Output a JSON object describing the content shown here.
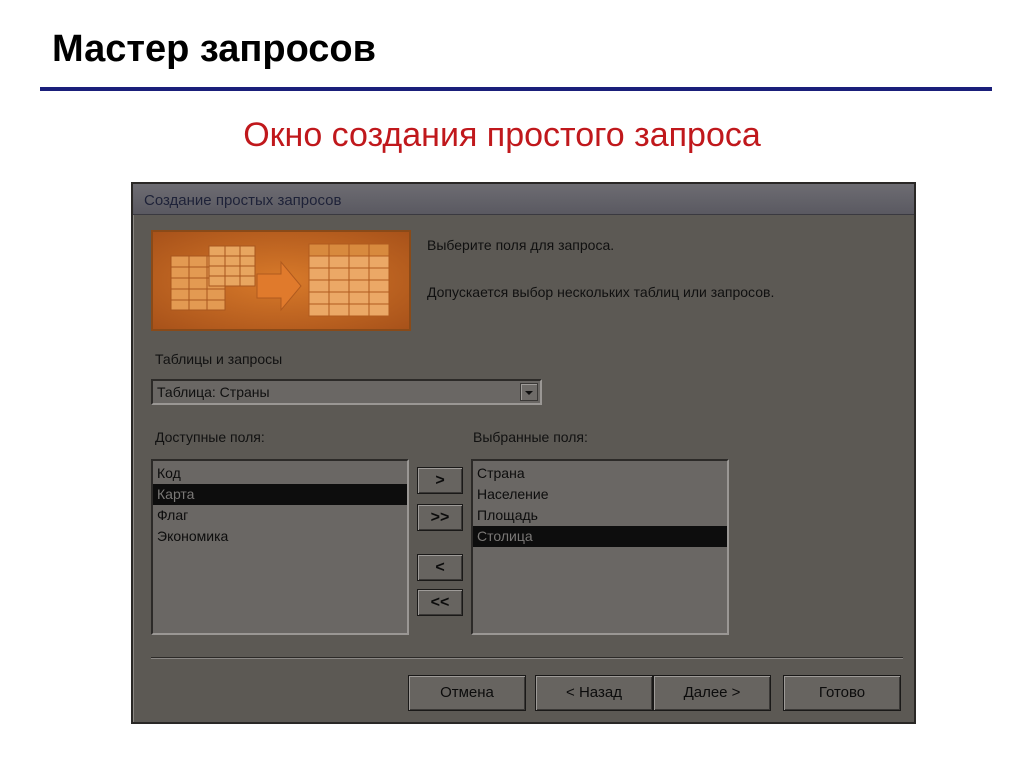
{
  "slide": {
    "title": "Мастер запросов",
    "subtitle": "Окно создания простого запроса"
  },
  "colors": {
    "title_rule": "#1a1f7a",
    "subtitle": "#c0181c",
    "dialog_bg": "#5c5954"
  },
  "dialog": {
    "title": "Создание простых запросов",
    "instruction_1": "Выберите поля для запроса.",
    "instruction_2": "Допускается выбор нескольких таблиц или запросов.",
    "tables_label": "Таблицы и запросы",
    "tables_combo": {
      "value": "Таблица: Страны",
      "icon": "chevron-down-icon"
    },
    "available_label": "Доступные поля:",
    "selected_label": "Выбранные поля:",
    "available_fields": [
      {
        "label": "Код",
        "selected": false
      },
      {
        "label": "Карта",
        "selected": true
      },
      {
        "label": "Флаг",
        "selected": false
      },
      {
        "label": "Экономика",
        "selected": false
      }
    ],
    "selected_fields": [
      {
        "label": "Страна",
        "selected": false
      },
      {
        "label": "Население",
        "selected": false
      },
      {
        "label": "Площадь",
        "selected": false
      },
      {
        "label": "Столица",
        "selected": true
      }
    ],
    "move_buttons": {
      "add": ">",
      "add_all": ">>",
      "remove": "<",
      "remove_all": "<<"
    },
    "buttons": {
      "cancel": "Отмена",
      "back": "< Назад",
      "next": "Далее >",
      "finish": "Готово"
    }
  }
}
